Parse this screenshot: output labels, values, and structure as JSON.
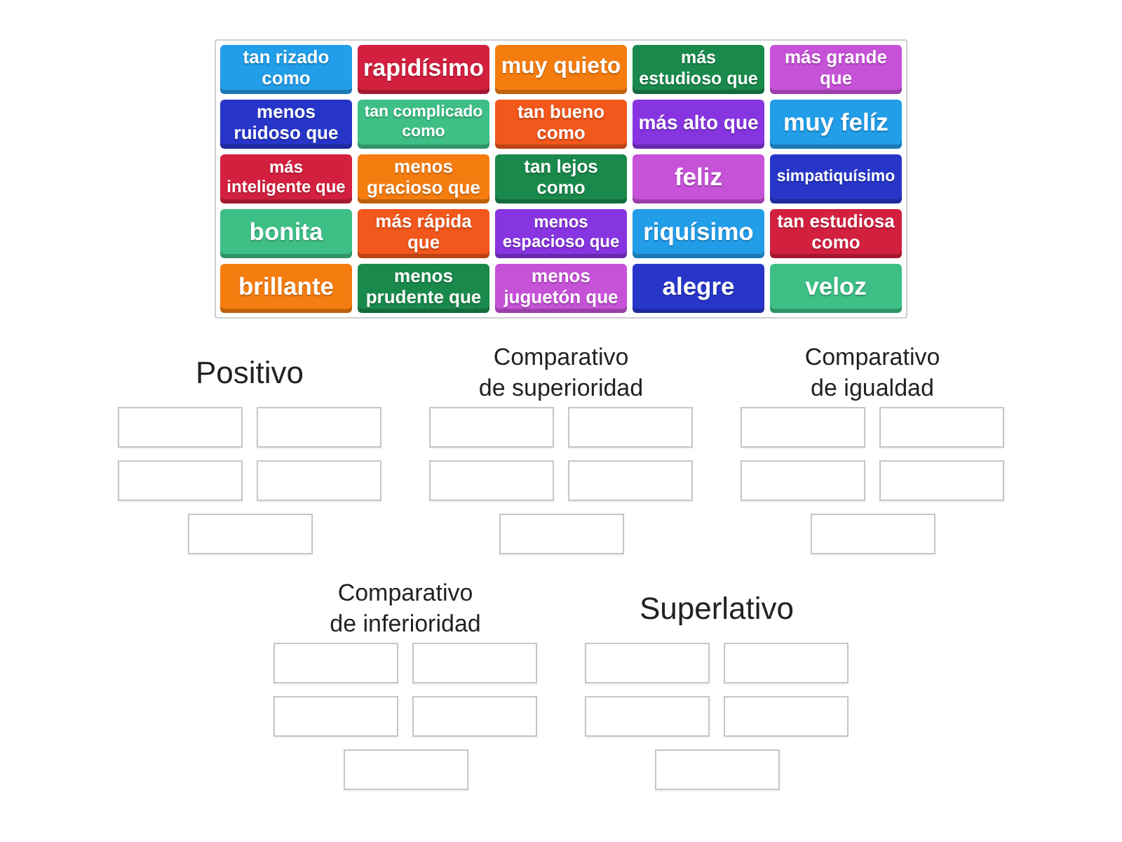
{
  "tiles": [
    {
      "text": "tan rizado como",
      "color": "#229de8"
    },
    {
      "text": "rapidísimo",
      "color": "#d3203f"
    },
    {
      "text": "muy quieto",
      "color": "#f57d0f"
    },
    {
      "text": "más estudioso que",
      "color": "#1a8a4c"
    },
    {
      "text": "más grande que",
      "color": "#c652d8"
    },
    {
      "text": "menos ruidoso que",
      "color": "#2736c9"
    },
    {
      "text": "tan complicado como",
      "color": "#3dbf86"
    },
    {
      "text": "tan bueno como",
      "color": "#f2571b"
    },
    {
      "text": "más alto que",
      "color": "#8635e0"
    },
    {
      "text": "muy felíz",
      "color": "#229de8"
    },
    {
      "text": "más inteligente que",
      "color": "#d3203f"
    },
    {
      "text": "menos gracioso que",
      "color": "#f57d0f"
    },
    {
      "text": "tan lejos como",
      "color": "#1a8a4c"
    },
    {
      "text": "feliz",
      "color": "#c652d8"
    },
    {
      "text": "simpatiquísimo",
      "color": "#2736c9"
    },
    {
      "text": "bonita",
      "color": "#3dbf86"
    },
    {
      "text": "más rápida que",
      "color": "#f2571b"
    },
    {
      "text": "menos espacioso que",
      "color": "#8635e0"
    },
    {
      "text": "riquísimo",
      "color": "#229de8"
    },
    {
      "text": "tan estudiosa como",
      "color": "#d3203f"
    },
    {
      "text": "brillante",
      "color": "#f57d0f"
    },
    {
      "text": "menos prudente que",
      "color": "#1a8a4c"
    },
    {
      "text": "menos juguetón que",
      "color": "#c652d8"
    },
    {
      "text": "alegre",
      "color": "#2736c9"
    },
    {
      "text": "veloz",
      "color": "#3dbf86"
    }
  ],
  "groups": [
    {
      "heading": "Positivo"
    },
    {
      "heading": "Comparativo de superioridad"
    },
    {
      "heading": "Comparativo de igualdad"
    },
    {
      "heading": "Comparativo de inferioridad"
    },
    {
      "heading": "Superlativo"
    }
  ]
}
